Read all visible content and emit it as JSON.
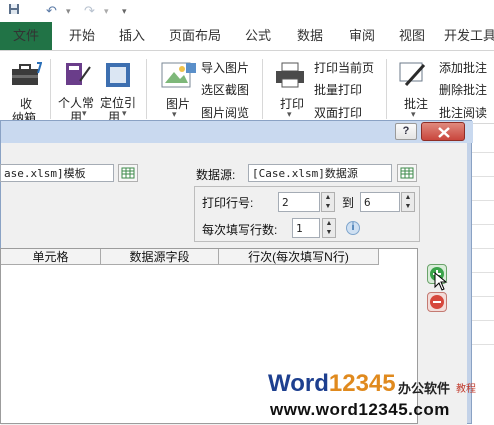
{
  "ribbon_tabs": [
    "文件",
    "开始",
    "插入",
    "页面布局",
    "公式",
    "数据",
    "审阅",
    "视图",
    "开发工具"
  ],
  "ribbon": {
    "group1": {
      "big_button_line1": "收",
      "big_button_line2": "纳箱"
    },
    "group2": {
      "personal_line1": "个人常",
      "personal_line2": "用",
      "locate_line1": "定位引",
      "locate_line2": "用"
    },
    "group3": {
      "picture": "图片",
      "import_picture": "导入图片",
      "region_screenshot": "选区截图",
      "picture_browse": "图片阅览"
    },
    "group4": {
      "print": "打印",
      "print_current": "打印当前页",
      "batch_print": "批量打印",
      "duplex_print": "双面打印"
    },
    "group5": {
      "comment": "批注",
      "add_comment": "添加批注",
      "delete_comment": "删除批注",
      "comment_read": "批注阅读"
    }
  },
  "dialog": {
    "help_label": "?",
    "template_value": "ase.xlsm]模板",
    "datasource_label": "数据源:",
    "datasource_value": "[Case.xlsm]数据源",
    "print_row_label": "打印行号:",
    "print_row_from": "2",
    "to_label": "到",
    "print_row_to": "6",
    "rows_per_fill_label": "每次填写行数:",
    "rows_per_fill": "1",
    "info_icon_text": "i",
    "grid_columns": [
      "单元格",
      "数据源字段",
      "行次(每次填写N行)"
    ]
  },
  "watermark": {
    "word_part": "Word",
    "number_part": "12345",
    "chinese_part": "办公软件",
    "tutorial": "教程",
    "url": "www.word12345.com"
  },
  "colors": {
    "excel_green": "#217346",
    "dialog_frame": "#c3d2e8",
    "close_red": "#c9463d"
  }
}
